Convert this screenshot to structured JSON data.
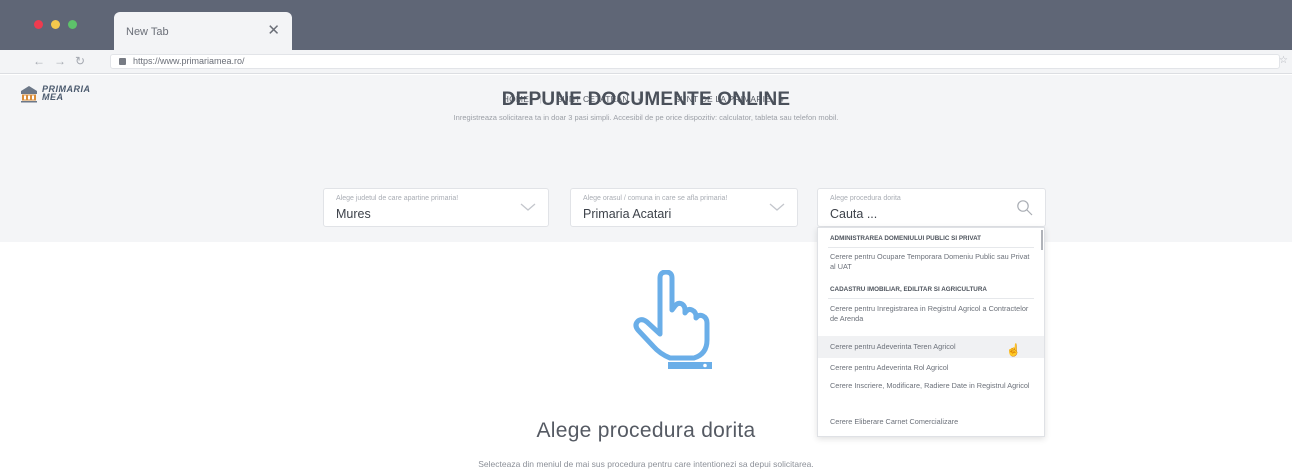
{
  "browser": {
    "tab_title": "New Tab",
    "tab_close": "✕",
    "url": "https://www.primariamea.ro/",
    "traffic_colors": {
      "close": "#ee3b4f",
      "minimize": "#f5c84c",
      "zoom": "#5dc26a"
    }
  },
  "logo": {
    "line1": "PRIMARIA",
    "line2": "MEA"
  },
  "nav": {
    "home": "HOME",
    "citizen": "SUNT CETATEAN",
    "town_hall": "SUNT DE LA PRIMARIE"
  },
  "hero": {
    "title": "DEPUNE DOCUMENTE ONLINE",
    "subtitle": "Inregistreaza solicitarea ta in doar 3 pasi simpli. Accesibil de pe orice dispozitiv: calculator, tableta sau telefon mobil."
  },
  "filters": {
    "county": {
      "label": "Alege judetul de care apartine primaria!",
      "value": "Mures"
    },
    "city": {
      "label": "Alege orasul / comuna in care se afla primaria!",
      "value": "Primaria Acatari"
    },
    "procedure": {
      "label": "Alege procedura dorita",
      "placeholder": "Cauta ..."
    }
  },
  "dropdown": {
    "items": [
      {
        "kind": "group",
        "text": "ADMINISTRAREA DOMENIULUI PUBLIC SI PRIVAT"
      },
      {
        "kind": "item",
        "text": "Cerere pentru Ocupare Temporara Domeniu Public sau Privat al UAT"
      },
      {
        "kind": "group",
        "text": "CADASTRU IMOBILIAR, EDILITAR SI AGRICULTURA"
      },
      {
        "kind": "item",
        "text": "Cerere pentru Inregistrarea in Registrul Agricol a Contractelor de Arenda"
      },
      {
        "kind": "item",
        "text": "Cerere pentru Adeverinta Teren Agricol",
        "hovered": true
      },
      {
        "kind": "item",
        "text": "Cerere pentru Adeverinta Rol Agricol"
      },
      {
        "kind": "item",
        "text": "Cerere Inscriere, Modificare, Radiere Date in Registrul Agricol"
      },
      {
        "kind": "item",
        "text": "Cerere Eliberare Carnet Comercializare"
      }
    ]
  },
  "empty_state": {
    "title": "Alege procedura dorita",
    "subtitle": "Selecteaza din meniul de mai sus procedura pentru care intentionezi sa depui solicitarea.",
    "icon": "pointing-hand-icon",
    "icon_color": "#6aaee8"
  }
}
